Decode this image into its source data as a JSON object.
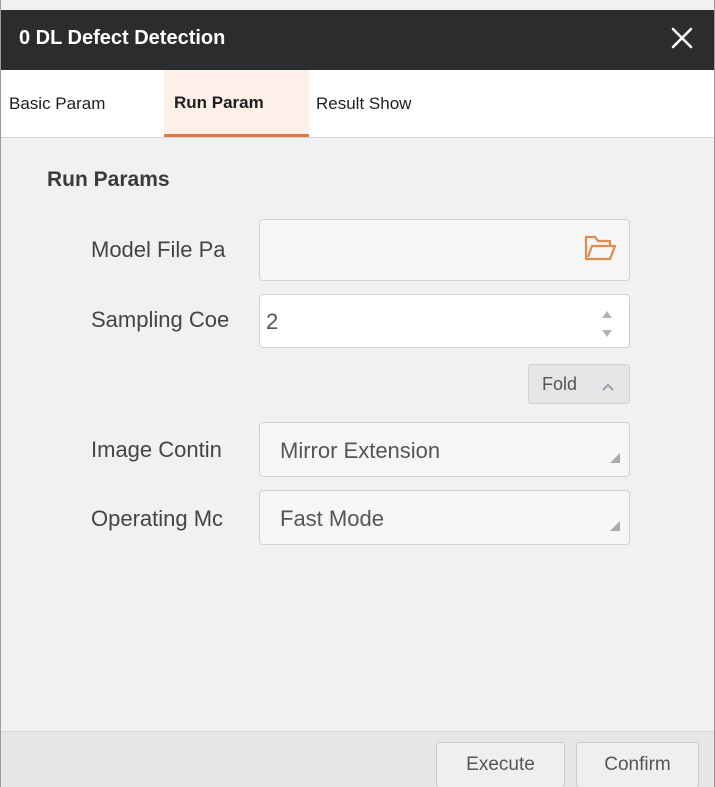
{
  "dialog": {
    "title": "0 DL Defect Detection",
    "close_icon": "close-icon"
  },
  "tabs": [
    {
      "label": "Basic Param",
      "active": false
    },
    {
      "label": "Run Param",
      "active": true
    },
    {
      "label": "Result Show",
      "active": false
    }
  ],
  "section": {
    "title": "Run Params"
  },
  "fields": {
    "model_file": {
      "label": "Model File Pa",
      "value": "",
      "icon": "folder-icon"
    },
    "sampling": {
      "label": "Sampling Coe",
      "value": "2"
    },
    "image_continuation": {
      "label": "Image Contin",
      "value": "Mirror Extension"
    },
    "operating_mode": {
      "label": "Operating Mc",
      "value": "Fast Mode"
    }
  },
  "fold_button": {
    "label": "Fold",
    "icon": "chevron-up-icon"
  },
  "footer": {
    "execute_label": "Execute",
    "confirm_label": "Confirm"
  },
  "colors": {
    "titlebar": "#2b2c2e",
    "accent": "#e07a3c",
    "panel": "#f0f1f3"
  }
}
